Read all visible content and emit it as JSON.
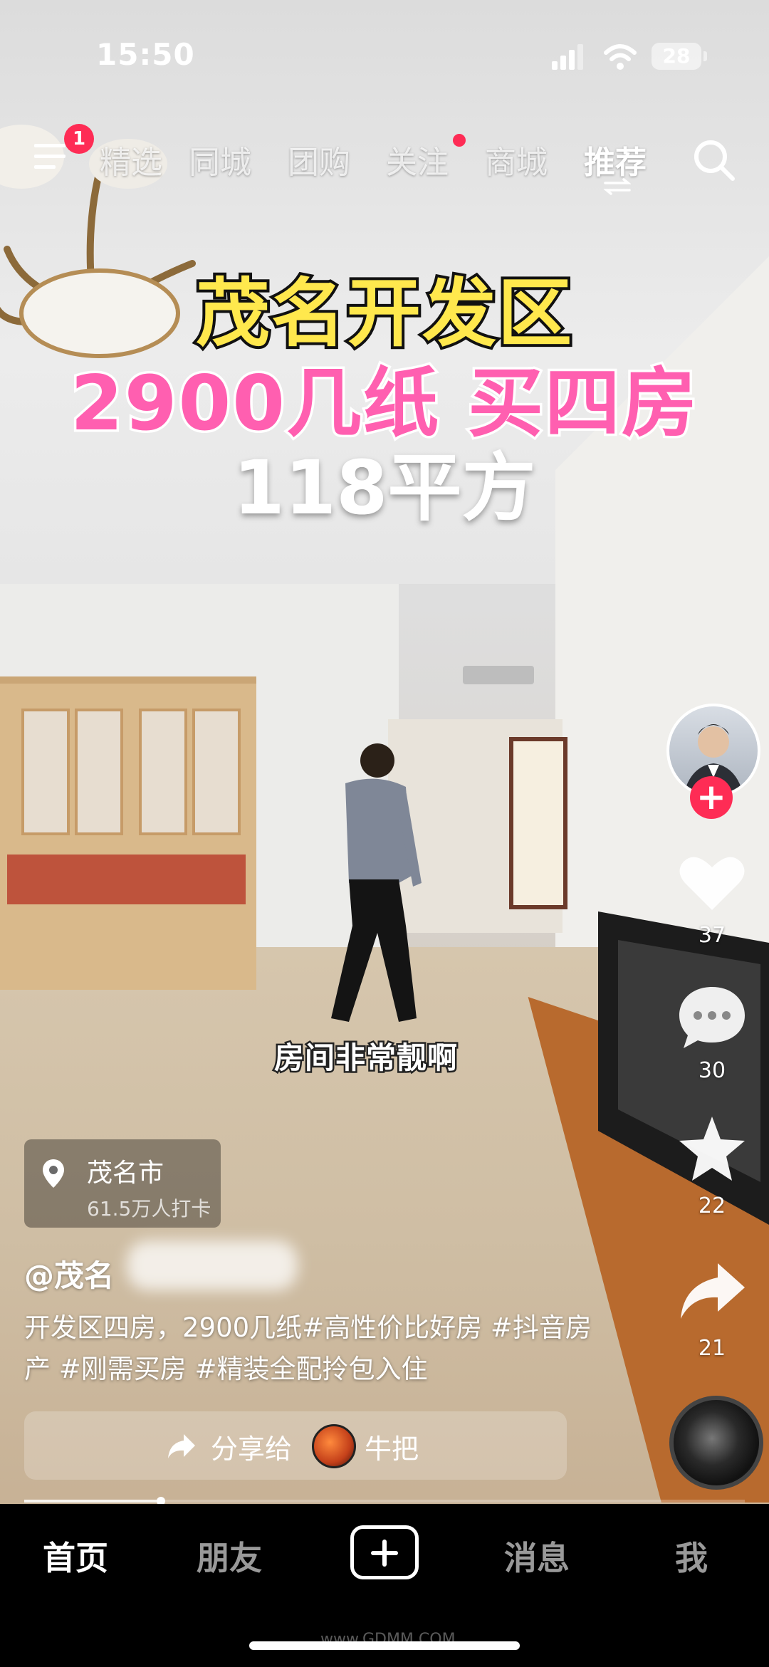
{
  "status_bar": {
    "time": "15:50",
    "battery": "28"
  },
  "top_nav": {
    "menu_badge": "1",
    "tabs": [
      "精选",
      "同城",
      "团购",
      "关注",
      "商城",
      "推荐"
    ],
    "active_tab": "推荐"
  },
  "video_overlay": {
    "title_line1": "茂名开发区",
    "title_line2": "2900几纸 买四房",
    "title_line3": "118平方",
    "caption": "房间非常靓啊"
  },
  "right_rail": {
    "follow": "+",
    "likes": "37",
    "comments": "30",
    "favorites": "22",
    "shares": "21"
  },
  "location": {
    "name": "茂名市",
    "checkins": "61.5万人打卡"
  },
  "author": {
    "handle": "@茂名"
  },
  "description": "开发区四房，2900几纸#高性价比好房 #抖音房产 #刚需买房 #精装全配拎包入住",
  "share": {
    "label": "分享给",
    "name": "牛把"
  },
  "progress": {
    "fraction": 0.19
  },
  "bottom_nav": {
    "home": "首页",
    "friends": "朋友",
    "messages": "消息",
    "me": "我"
  },
  "watermark": "www.GDMM.COM",
  "colors": {
    "accent": "#fe2c55",
    "title_yellow": "#ffe84d",
    "title_pink": "#ff5fb0"
  }
}
